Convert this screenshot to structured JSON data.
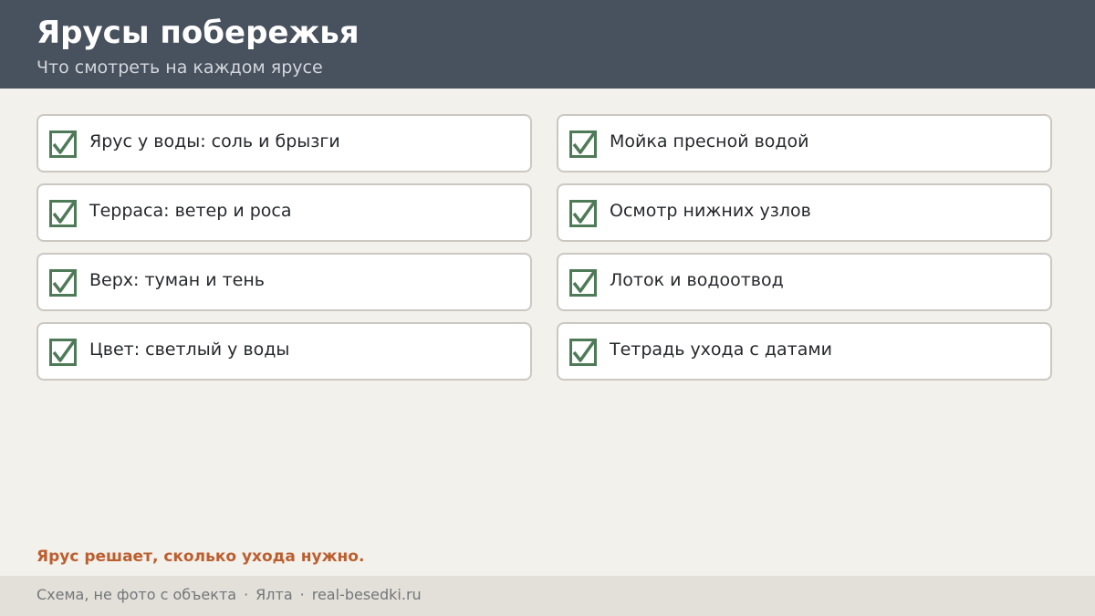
{
  "header": {
    "title": "Ярусы побережья",
    "subtitle": "Что смотреть на каждом ярусе"
  },
  "checklist": {
    "left": [
      {
        "label": "Ярус у воды: соль и брызги",
        "checked": true
      },
      {
        "label": "Терраса: ветер и роса",
        "checked": true
      },
      {
        "label": "Верх: туман и тень",
        "checked": true
      },
      {
        "label": "Цвет: светлый у воды",
        "checked": true
      }
    ],
    "right": [
      {
        "label": "Мойка пресной водой",
        "checked": true
      },
      {
        "label": "Осмотр нижних узлов",
        "checked": true
      },
      {
        "label": "Лоток и водоотвод",
        "checked": true
      },
      {
        "label": "Тетрадь ухода с датами",
        "checked": true
      }
    ]
  },
  "note": "Ярус решает, сколько ухода нужно.",
  "footer": {
    "caption": "Схема, не фото с объекта",
    "location": "Ялта",
    "site": "real-besedki.ru",
    "separator": "·"
  },
  "colors": {
    "header_bg": "#48515e",
    "page_bg": "#f3f1ec",
    "check_green": "#4f7a58",
    "accent": "#bb5f30",
    "footer_bg": "#e3e0d9"
  },
  "icons": {
    "check": "checkbox-checked-icon"
  }
}
